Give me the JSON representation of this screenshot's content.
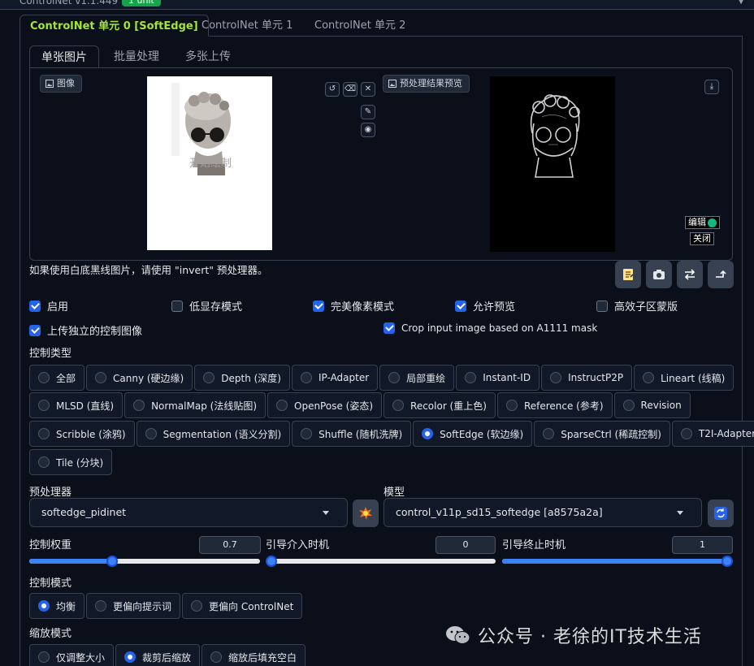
{
  "header": {
    "title": "ControlNet v1.1.449",
    "badge": "1 unit"
  },
  "unit_tabs": [
    "ControlNet 单元 0 [SoftEdge]",
    "ControlNet 单元 1",
    "ControlNet 单元 2"
  ],
  "input_tabs": [
    "单张图片",
    "批量处理",
    "多张上传"
  ],
  "image_panel": {
    "input_label": "图像",
    "input_overlay_text": "开始绘制",
    "preview_label": "预处理结果预览",
    "preview_edit": "编辑",
    "preview_close": "关闭"
  },
  "hint": "如果使用白底黑线图片，请使用 \"invert\" 预处理器。",
  "checkboxes": [
    {
      "label": "启用",
      "checked": true
    },
    {
      "label": "低显存模式",
      "checked": false
    },
    {
      "label": "完美像素模式",
      "checked": true
    },
    {
      "label": "允许预览",
      "checked": true
    },
    {
      "label": "高效子区蒙版",
      "checked": false
    },
    {
      "label": "上传独立的控制图像",
      "checked": true
    },
    {
      "label": "Crop input image based on A1111 mask",
      "checked": true
    }
  ],
  "control_type": {
    "label": "控制类型",
    "selected": "SoftEdge (软边缘)",
    "rows": [
      [
        "全部",
        "Canny (硬边缘)",
        "Depth (深度)",
        "IP-Adapter",
        "局部重绘",
        "Instant-ID",
        "InstructP2P",
        "Lineart (线稿)"
      ],
      [
        "MLSD (直线)",
        "NormalMap (法线贴图)",
        "OpenPose (姿态)",
        "Recolor (重上色)",
        "Reference (参考)",
        "Revision"
      ],
      [
        "Scribble (涂鸦)",
        "Segmentation (语义分割)",
        "Shuffle (随机洗牌)",
        "SoftEdge (软边缘)",
        "SparseCtrl (稀疏控制)",
        "T2I-Adapter"
      ],
      [
        "Tile (分块)"
      ]
    ]
  },
  "preprocessor": {
    "label": "预处理器",
    "value": "softedge_pidinet"
  },
  "model": {
    "label": "模型",
    "value": "control_v11p_sd15_softedge [a8575a2a]"
  },
  "sliders": [
    {
      "label": "控制权重",
      "value": "0.7",
      "fraction": 0.35
    },
    {
      "label": "引导介入时机",
      "value": "0",
      "fraction": 0.0
    },
    {
      "label": "引导终止时机",
      "value": "1",
      "fraction": 1.0
    }
  ],
  "control_mode": {
    "label": "控制模式",
    "options": [
      "均衡",
      "更偏向提示词",
      "更偏向 ControlNet"
    ],
    "selected": "均衡"
  },
  "resize_mode": {
    "label": "缩放模式",
    "options": [
      "仅调整大小",
      "裁剪后缩放",
      "缩放后填充空白"
    ],
    "selected": "裁剪后缩放"
  },
  "watermark": "公众号 · 老徐的IT技术生活",
  "colors": {
    "accent": "#a3e635",
    "primary": "#2563eb",
    "background": "#0b0f19"
  }
}
